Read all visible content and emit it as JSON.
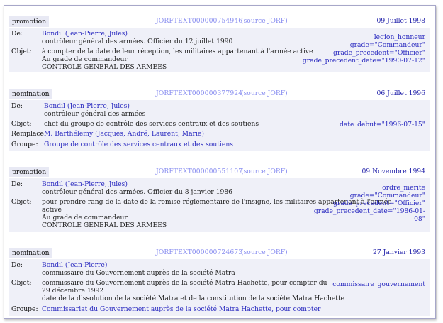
{
  "records": [
    {
      "type": "promotion",
      "ref": "JORFTEXT000000754946",
      "source": "(source JORF)",
      "date": "09 Juillet 1998",
      "de_label": "De:",
      "de_name": "Bondil (Jean-Pierre, Jules)",
      "de_desc": "contrôleur général des armées. Officier du 12 juillet 1990",
      "objet_label": "Objet:",
      "objet_lines": [
        "à compter de la date de leur réception, les militaires appartenant à l'armée active",
        "Au grade de commandeur",
        "CONTROLE GENERAL DES ARMEES"
      ],
      "tags": [
        "legion_honneur",
        "grade=\"Commandeur\"",
        "grade_precedent=\"Officier\"",
        "grade_precedent_date=\"1990-07-12\""
      ]
    },
    {
      "type": "nomination",
      "ref": "JORFTEXT000000377924",
      "source": "(source JORF)",
      "date": "06 Juillet 1996",
      "de_label": "De:",
      "de_name": "Bondil (Jean-Pierre, Jules)",
      "de_desc": "contrôleur général des armées",
      "objet_label": "Objet:",
      "objet_lines": [
        "chef du groupe de contrôle des services centraux et des soutiens"
      ],
      "remplace_label": "Remplace:",
      "remplace_value": "M. Barthélemy (Jacques, André, Laurent, Marie)",
      "groupe_label": "Groupe:",
      "groupe_value": "Groupe de contrôle des services centraux et des soutiens",
      "tags": [
        "date_debut=\"1996-07-15\""
      ]
    },
    {
      "type": "promotion",
      "ref": "JORFTEXT000000551107",
      "source": "(source JORF)",
      "date": "09 Novembre 1994",
      "de_label": "De:",
      "de_name": "Bondil (Jean-Pierre, Jules)",
      "de_desc": "contrôleur général des armées. Officier du 8 janvier 1986",
      "objet_label": "Objet:",
      "objet_lines": [
        "pour prendre rang de la date de la remise réglementaire de l'insigne, les militaires appartenant à l'armée",
        "active",
        "Au grade de commandeur",
        "CONTROLE GENERAL DES ARMEES"
      ],
      "tags": [
        "ordre_merite",
        "grade=\"Commandeur\"",
        "grade_precedent=\"Officier\"",
        "grade_precedent_date=\"1986-01-",
        "08\""
      ]
    },
    {
      "type": "nomination",
      "ref": "JORFTEXT000000724673",
      "source": "(source JORF)",
      "date": "27 Janvier 1993",
      "de_label": "De:",
      "de_name": "Bondil (Jean-Pierre)",
      "de_desc": "commissaire du Gouvernement auprès de la société Matra",
      "objet_label": "Objet:",
      "objet_lines": [
        "commissaire du Gouvernement auprès de la société Matra Hachette, pour compter du",
        "29 décembre 1992",
        "date de la dissolution de la société Matra et de la constitution de la société Matra Hachette"
      ],
      "groupe_label": "Groupe:",
      "groupe_value": "Commissariat du Gouvernement auprès de la société Matra Hachette, pour compter",
      "tags": [
        "commissaire_gouvernement"
      ]
    }
  ]
}
